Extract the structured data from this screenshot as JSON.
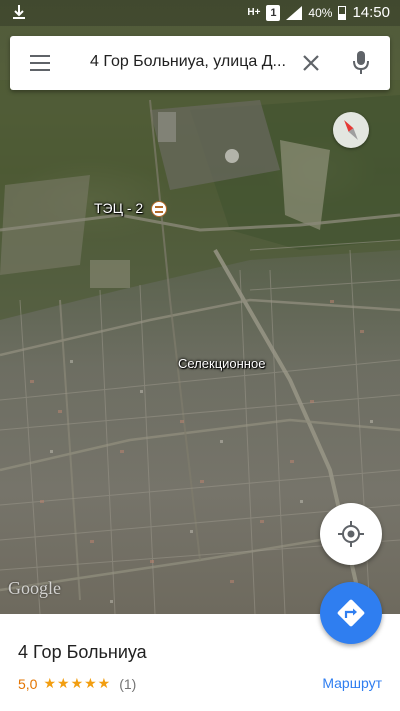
{
  "status_bar": {
    "download_icon": "download-icon",
    "network_label": "H+",
    "sim_label": "1",
    "battery_percent": "40%",
    "time": "14:50"
  },
  "search": {
    "query": "4 Гор Больниуа, улица Д...",
    "menu_icon": "hamburger-menu-icon",
    "close_icon": "close-icon",
    "mic_icon": "microphone-icon"
  },
  "map": {
    "labels": {
      "power_plant": "ТЭЦ - 2",
      "district": "Селекционное"
    },
    "poi_icon": "landmark-icon",
    "attribution": "Google",
    "compass_icon": "compass-icon"
  },
  "controls": {
    "my_location_icon": "my-location-icon",
    "directions_icon": "directions-icon"
  },
  "place": {
    "name": "4 Гор Больниуа",
    "rating": "5,0",
    "stars": "★★★★★",
    "review_count": "(1)",
    "route_label": "Маршрут"
  },
  "colors": {
    "accent": "#2f7ef0",
    "rating": "#e37400",
    "star": "#f29e10"
  }
}
